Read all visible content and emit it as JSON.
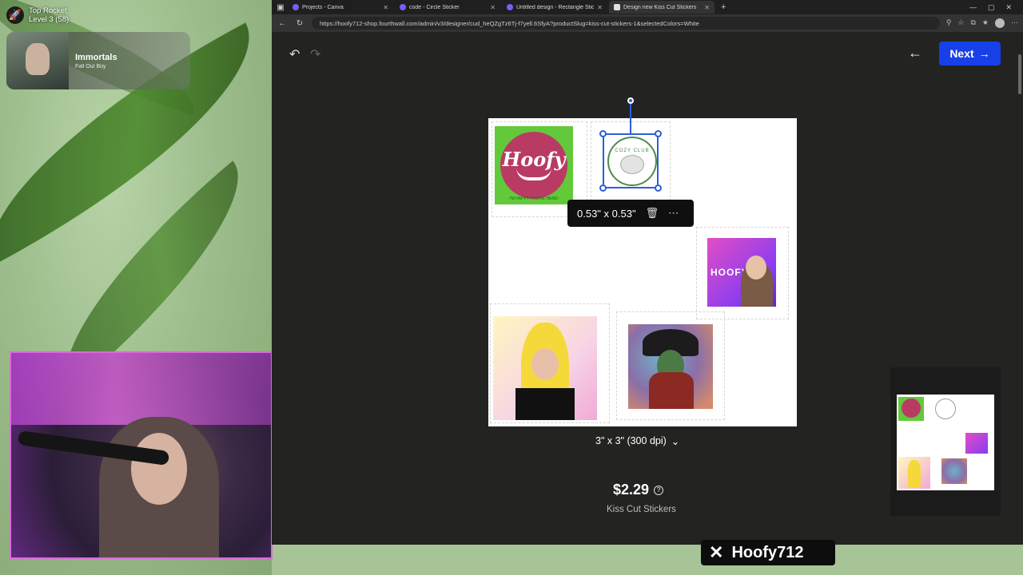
{
  "overlay": {
    "rank_title": "Top Rocket",
    "rank_level": "Level 3 (58)",
    "now_playing": {
      "title": "Immortals",
      "artist": "Fall Out Boy"
    },
    "brand": "Hoofy712"
  },
  "browser": {
    "tabs": [
      {
        "label": "Projects - Canva",
        "color": "#7b5cff",
        "active": false
      },
      {
        "label": "code - Circle Sticker",
        "color": "#7b5cff",
        "active": false
      },
      {
        "label": "Untitled design - Rectangle Sticke",
        "color": "#7b5cff",
        "active": false
      },
      {
        "label": "Design new Kiss Cut Stickers",
        "color": "#e0e0e0",
        "active": true
      }
    ],
    "url": "https://hoofy712-shop.fourthwall.com/admin/v3/designer/cud_heQZgTz6Tj-f7yell.6SfyA?productSlug=kiss-cut-stickers-1&selectedColors=White"
  },
  "editor": {
    "next_label": "Next",
    "size_popup": "0.53\" x 0.53\"",
    "size_select": "3\" x 3\" (300 dpi)",
    "price": "$2.29",
    "product_name": "Kiss Cut Stickers",
    "stickers": {
      "hoofy_word": "Hoofy",
      "hoofy_tag": "I'M HAPPY YOU'RE HERE!",
      "cozy_text": "COZY CLUB",
      "jar_word": "HOOFY"
    }
  },
  "colors": {
    "accent": "#1740e8",
    "selection": "#2b5fd9"
  }
}
